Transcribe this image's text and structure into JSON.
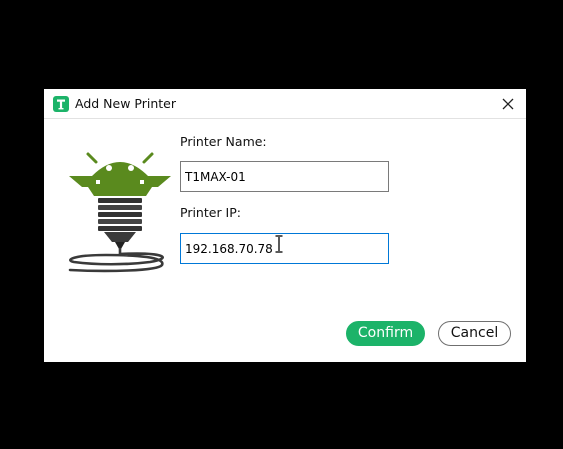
{
  "dialog": {
    "title": "Add New Printer",
    "app_icon": "t-printer-app-icon",
    "close_icon": "close-icon"
  },
  "illustration": {
    "icon": "3d-printer-nozzle-icon",
    "accent_color": "#5a8a1e"
  },
  "form": {
    "name_label": "Printer Name:",
    "name_value": "T1MAX-01",
    "ip_label": "Printer IP:",
    "ip_value": "192.168.70.78"
  },
  "buttons": {
    "confirm_label": "Confirm",
    "cancel_label": "Cancel"
  },
  "colors": {
    "confirm_bg": "#1cb369",
    "focus_border": "#0078d7"
  }
}
